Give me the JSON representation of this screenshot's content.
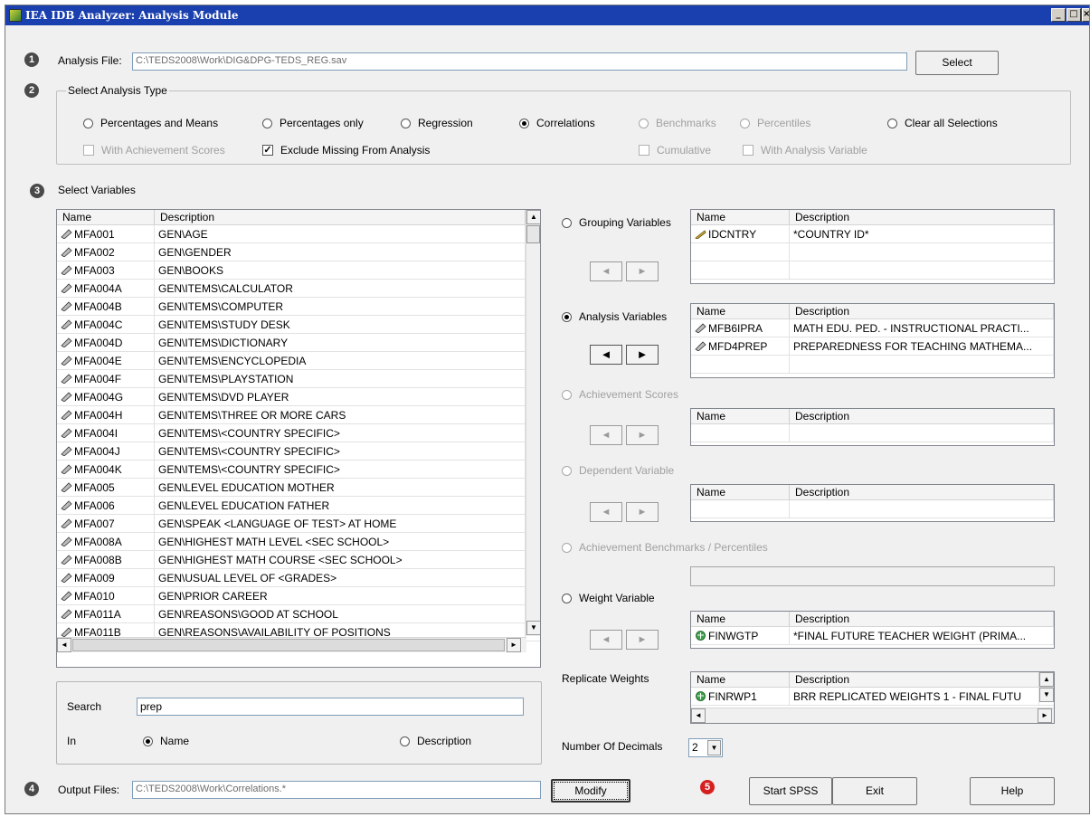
{
  "window": {
    "title": "IEA IDB Analyzer: Analysis Module"
  },
  "step_numbers": [
    "1",
    "2",
    "3",
    "4",
    "5"
  ],
  "analysis_file": {
    "label": "Analysis File:",
    "value": "C:\\TEDS2008\\Work\\DIG&DPG-TEDS_REG.sav",
    "button": "Select"
  },
  "analysis_type": {
    "legend": "Select Analysis Type",
    "options": [
      {
        "label": "Percentages and Means",
        "selected": false,
        "enabled": true
      },
      {
        "label": "Percentages only",
        "selected": false,
        "enabled": true
      },
      {
        "label": "Regression",
        "selected": false,
        "enabled": true
      },
      {
        "label": "Correlations",
        "selected": true,
        "enabled": true
      },
      {
        "label": "Benchmarks",
        "selected": false,
        "enabled": false
      },
      {
        "label": "Percentiles",
        "selected": false,
        "enabled": false
      },
      {
        "label": "Clear all Selections",
        "selected": false,
        "enabled": true
      }
    ],
    "checks": [
      {
        "label": "With Achievement Scores",
        "checked": false,
        "enabled": false
      },
      {
        "label": "Exclude Missing From Analysis",
        "checked": true,
        "enabled": true
      },
      {
        "label": "Cumulative",
        "checked": false,
        "enabled": false
      },
      {
        "label": "With Analysis Variable",
        "checked": false,
        "enabled": false
      }
    ]
  },
  "select_variables": {
    "label": "Select Variables",
    "columns": [
      "Name",
      "Description"
    ],
    "rows": [
      [
        "MFA001",
        "GEN\\AGE"
      ],
      [
        "MFA002",
        "GEN\\GENDER"
      ],
      [
        "MFA003",
        "GEN\\BOOKS"
      ],
      [
        "MFA004A",
        "GEN\\ITEMS\\CALCULATOR"
      ],
      [
        "MFA004B",
        "GEN\\ITEMS\\COMPUTER"
      ],
      [
        "MFA004C",
        "GEN\\ITEMS\\STUDY DESK"
      ],
      [
        "MFA004D",
        "GEN\\ITEMS\\DICTIONARY"
      ],
      [
        "MFA004E",
        "GEN\\ITEMS\\ENCYCLOPEDIA"
      ],
      [
        "MFA004F",
        "GEN\\ITEMS\\PLAYSTATION"
      ],
      [
        "MFA004G",
        "GEN\\ITEMS\\DVD PLAYER"
      ],
      [
        "MFA004H",
        "GEN\\ITEMS\\THREE OR MORE CARS"
      ],
      [
        "MFA004I",
        "GEN\\ITEMS\\<COUNTRY SPECIFIC>"
      ],
      [
        "MFA004J",
        "GEN\\ITEMS\\<COUNTRY SPECIFIC>"
      ],
      [
        "MFA004K",
        "GEN\\ITEMS\\<COUNTRY SPECIFIC>"
      ],
      [
        "MFA005",
        "GEN\\LEVEL EDUCATION MOTHER"
      ],
      [
        "MFA006",
        "GEN\\LEVEL EDUCATION FATHER"
      ],
      [
        "MFA007",
        "GEN\\SPEAK <LANGUAGE OF TEST> AT HOME"
      ],
      [
        "MFA008A",
        "GEN\\HIGHEST MATH LEVEL <SEC SCHOOL>"
      ],
      [
        "MFA008B",
        "GEN\\HIGHEST MATH COURSE <SEC SCHOOL>"
      ],
      [
        "MFA009",
        "GEN\\USUAL LEVEL OF <GRADES>"
      ],
      [
        "MFA010",
        "GEN\\PRIOR CAREER"
      ],
      [
        "MFA011A",
        "GEN\\REASONS\\GOOD AT SCHOOL"
      ],
      [
        "MFA011B",
        "GEN\\REASONS\\AVAILABILITY OF POSITIONS"
      ]
    ]
  },
  "search": {
    "label": "Search",
    "value": "prep",
    "in_label": "In",
    "in_options": [
      {
        "label": "Name",
        "selected": true
      },
      {
        "label": "Description",
        "selected": false
      }
    ]
  },
  "groups": {
    "grouping": {
      "label": "Grouping Variables",
      "columns": [
        "Name",
        "Description"
      ],
      "rows": [
        [
          "IDCNTRY",
          "*COUNTRY ID*"
        ]
      ]
    },
    "analysis": {
      "label": "Analysis Variables",
      "columns": [
        "Name",
        "Description"
      ],
      "rows": [
        [
          "MFB6IPRA",
          "MATH EDU. PED. - INSTRUCTIONAL PRACTI..."
        ],
        [
          "MFD4PREP",
          "PREPAREDNESS FOR TEACHING MATHEMA..."
        ]
      ]
    },
    "achievement": {
      "label": "Achievement Scores",
      "columns": [
        "Name",
        "Description"
      ]
    },
    "dependent": {
      "label": "Dependent Variable",
      "columns": [
        "Name",
        "Description"
      ]
    },
    "benchmarks": {
      "label": "Achievement Benchmarks / Percentiles"
    },
    "weight": {
      "label": "Weight Variable",
      "columns": [
        "Name",
        "Description"
      ],
      "rows": [
        [
          "FINWGTP",
          "*FINAL FUTURE TEACHER WEIGHT (PRIMA..."
        ]
      ]
    },
    "replicate": {
      "label": "Replicate Weights",
      "columns": [
        "Name",
        "Description"
      ],
      "rows": [
        [
          "FINRWP1",
          "BRR REPLICATED WEIGHTS 1 - FINAL FUTU"
        ]
      ]
    }
  },
  "decimals": {
    "label": "Number Of Decimals",
    "value": "2"
  },
  "output_files": {
    "label": "Output Files:",
    "value": "C:\\TEDS2008\\Work\\Correlations.*",
    "button": "Modify"
  },
  "actions": {
    "start": "Start SPSS",
    "exit": "Exit",
    "help": "Help"
  }
}
